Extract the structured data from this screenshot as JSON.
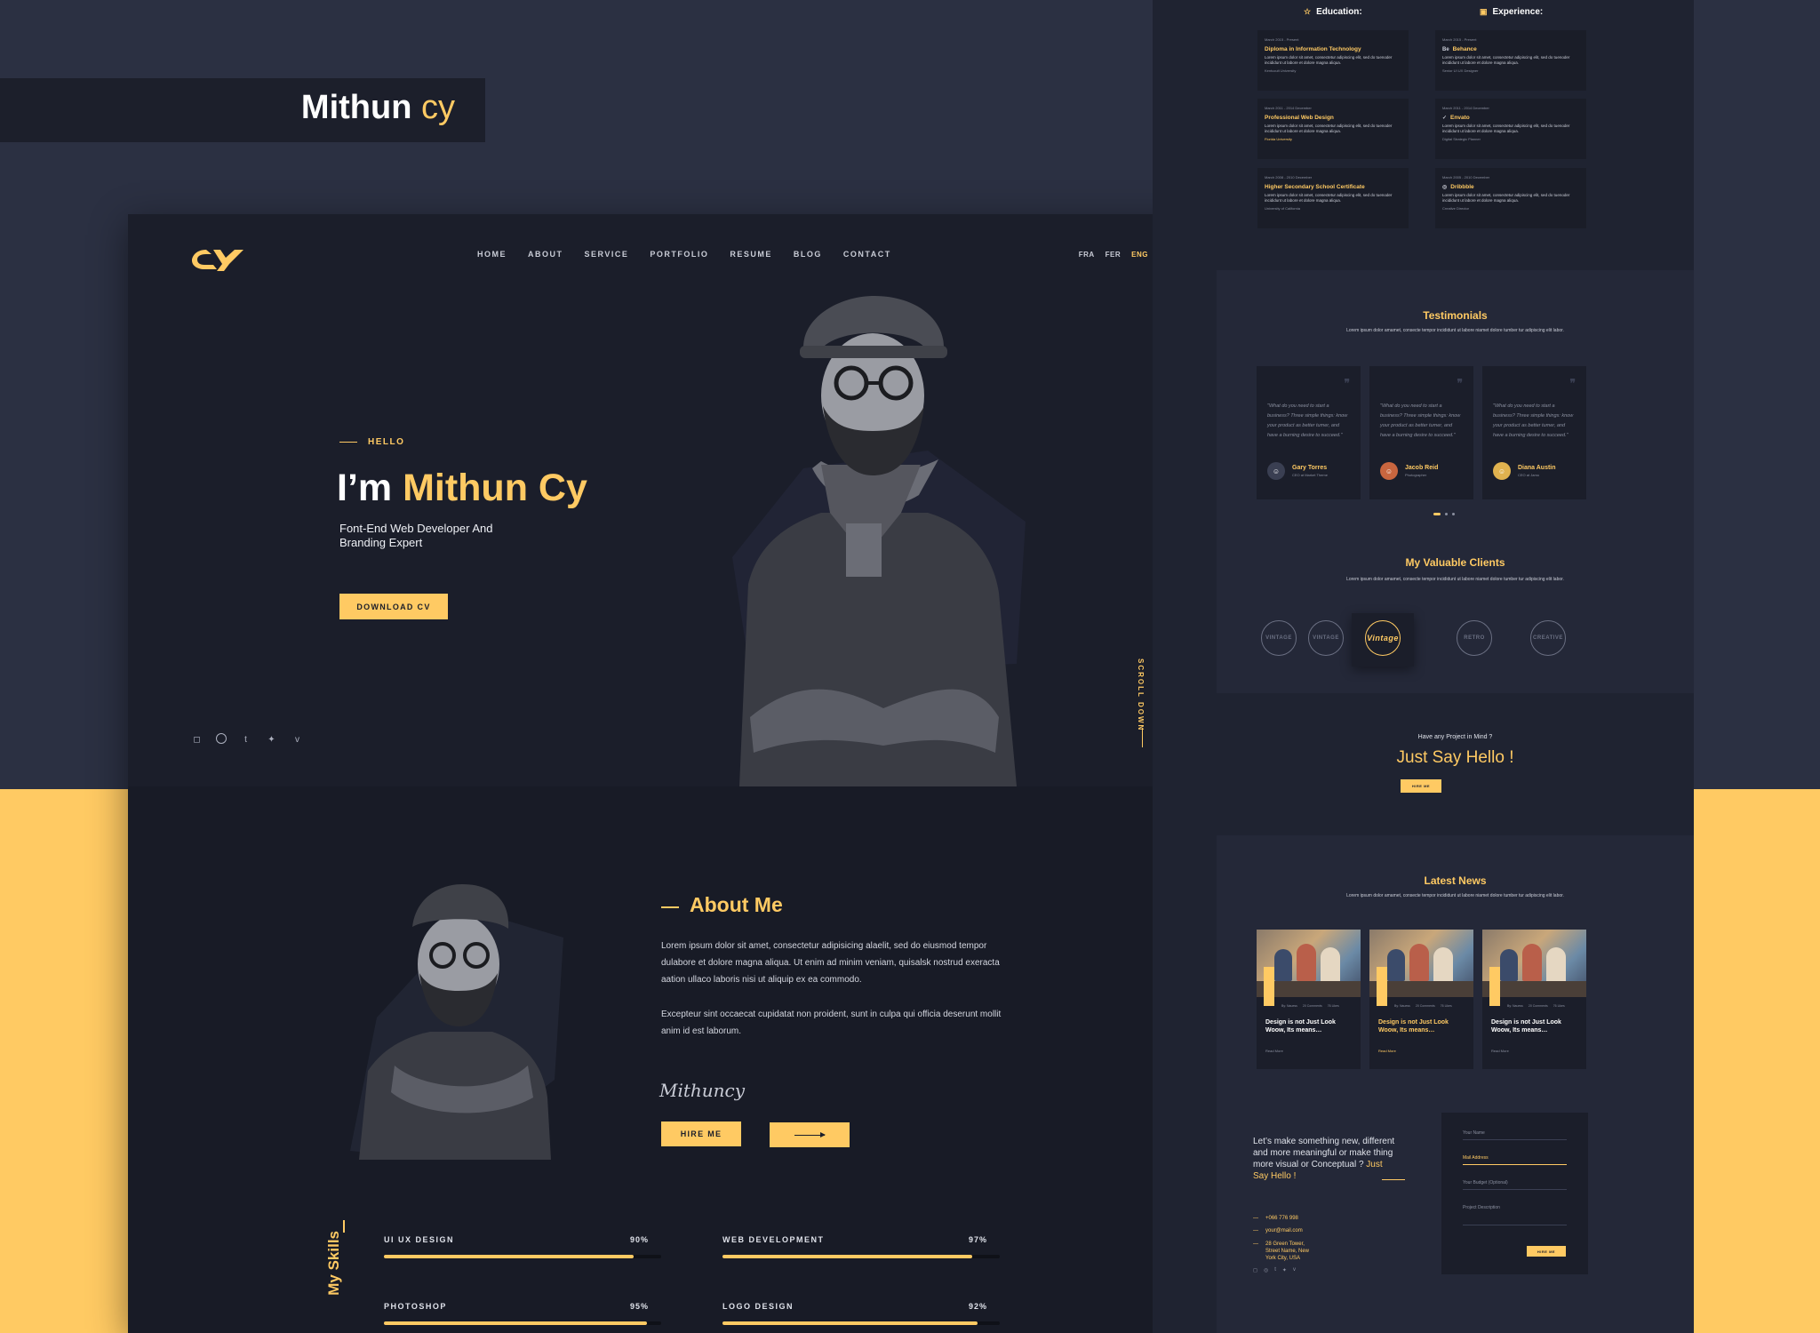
{
  "banner": {
    "first": "Mithun",
    "second": "cy"
  },
  "hero": {
    "nav": [
      "HOME",
      "ABOUT",
      "SERVICE",
      "PORTFOLIO",
      "RESUME",
      "BLOG",
      "CONTACT"
    ],
    "langs": [
      "FRA",
      "FER",
      "ENG"
    ],
    "active_lang": "ENG",
    "hello": "HELLO",
    "name_prefix": "I’m ",
    "name_highlight": "Mithun Cy",
    "subtitle": "Font-End Web Developer And Branding Expert",
    "download_label": "DOWNLOAD CV",
    "scroll_label": "SCROLL DOWN",
    "socials": [
      "instagram-icon",
      "dribbble-icon",
      "tumblr-icon",
      "twitter-icon",
      "vimeo-icon"
    ]
  },
  "about": {
    "title": "About Me",
    "p1": "Lorem ipsum dolor sit amet, consectetur adipisicing  alaelit, sed do eiusmod tempor dulabore et dolore magna aliqua. Ut enim ad minim veniam, quisalsk nostrud exeracta aation ullaco laboris nisi ut aliquip ex ea commodo.",
    "p2": "Excepteur sint occaecat cupidatat non proident, sunt in culpa qui officia deserunt mollit anim id est laborum.",
    "signature": "Mithuncy",
    "hire_label": "HIRE ME"
  },
  "skills": {
    "title": "My Skills",
    "items": [
      {
        "name": "UI UX DESIGN",
        "pct_label": "90%",
        "pct": 0.9
      },
      {
        "name": "WEB DEVELOPMENT",
        "pct_label": "97%",
        "pct": 0.9
      },
      {
        "name": "PHOTOSHOP",
        "pct_label": "95%",
        "pct": 0.95
      },
      {
        "name": "LOGO DESIGN",
        "pct_label": "92%",
        "pct": 0.92
      }
    ]
  },
  "resume": {
    "education_title": "Education:",
    "experience_title": "Experience:",
    "education": [
      {
        "date": "March 2015 - Present",
        "title": "Diploma in Information Technology",
        "desc": "Lorem ipsum dolor sit amet, consectetur adipiscing elit, sed do tuenoder incididunt ut labore et dolore magna aliqua.",
        "sub": "Kentucult University"
      },
      {
        "date": "March 2011 - 2014 December",
        "title": "Professional Web Design",
        "desc": "Lorem ipsum dolor sit amet, consectetur adipiscing elit, sed do tuenoder incididunt ut labore et dolore magna aliqua.",
        "sub": "Florida University"
      },
      {
        "date": "March 2008 - 2010 December",
        "title": "Higher Secondary School Certificate",
        "desc": "Lorem ipsum dolor sit amet, consectetur adipiscing elit, sed do tuenoder incididunt ut labore et dolore magna aliqua.",
        "sub": "University of California"
      }
    ],
    "experience": [
      {
        "date": "March 2015 - Present",
        "title": "Behance",
        "badge": "Be",
        "desc": "Lorem ipsum dolor sit amet, consectetur adipiscing elit, sed do tuenoder incididunt ut labore et dolore magna aliqua.",
        "sub": "Senior UI UX Designer"
      },
      {
        "date": "March 2011 - 2014 December",
        "title": "Envato",
        "badge": "✓",
        "desc": "Lorem ipsum dolor sit amet, consectetur adipiscing elit, sed do tuenoder incididunt ut labore et dolore magna aliqua.",
        "sub": "Digital Strategic Planner"
      },
      {
        "date": "March 2005 - 2010 December",
        "title": "Dribbble",
        "badge": "◎",
        "desc": "Lorem ipsum dolor sit amet, consectetur adipiscing elit, sed do tuenoder incididunt ut labore et dolore magna aliqua.",
        "sub": "Creative Director"
      }
    ]
  },
  "testimonials": {
    "title": "Testimonials",
    "desc": "Lorem ipsum dolor amamet, consecte tempor incididunt ut labore niamet dolore tumber tur adipiscing elit labor.",
    "items": [
      {
        "quote": "\"What do you need to start a business? Three simple things: know your product as better tumer, and have a burning desire to succeed.\"",
        "name": "Gary Torres",
        "role": "CEO at Market Theme"
      },
      {
        "quote": "\"What do you need to start a business? Three simple things: know your product as better tumer, and have a burning desire to succeed.\"",
        "name": "Jacob Reid",
        "role": "Photographer"
      },
      {
        "quote": "\"What do you need to start a business? Three simple things: know your product as better tumer, and have a burning desire to succeed.\"",
        "name": "Diana Austin",
        "role": "CEO at Jamo"
      }
    ]
  },
  "clients": {
    "title": "My Valuable Clients",
    "desc": "Lorem ipsum dolor amamet, consecte tempor incididunt ut labore niamet dolore tumber tur adipiscing elit labor.",
    "items": [
      "VINTAGE",
      "VINTAGE",
      "Vintage",
      "RETRO",
      "CREATIVE"
    ]
  },
  "hello": {
    "question": "Have any Project in Mind ?",
    "headline": "Just Say Hello !",
    "button": "HIRE ME"
  },
  "news": {
    "title": "Latest News",
    "desc": "Lorem ipsum dolor amamet, consecte tempor incididunt ut labore niamet dolore tumber tur adipiscing elit labor.",
    "items": [
      {
        "meta": [
          "By: Nauess",
          "20 Comments",
          "76 Likes"
        ],
        "title": "Design is not Just Look Woow, Its means…",
        "more": "Read More"
      },
      {
        "meta": [
          "By: Nauess",
          "20 Comments",
          "76 Likes"
        ],
        "title": "Design is not Just Look Woow, Its means…",
        "more": "Read More"
      },
      {
        "meta": [
          "By: Nauess",
          "20 Comments",
          "76 Likes"
        ],
        "title": "Design is not Just Look Woow, Its means…",
        "more": "Read More"
      }
    ]
  },
  "contact": {
    "tagline": "Let’s make something new, different and more meaningful or make thing more visual or Conceptual ? ",
    "tagline_hl": "Just Say Hello !",
    "phone": "+066 776 998",
    "email": "your@mail.com",
    "address": "28 Green Tower, Street Name, New York City, USA",
    "fields": [
      "Your Name",
      "Mail Address",
      "Your Budget (Optional)",
      "Project Description"
    ],
    "send": "HIRE ME"
  }
}
